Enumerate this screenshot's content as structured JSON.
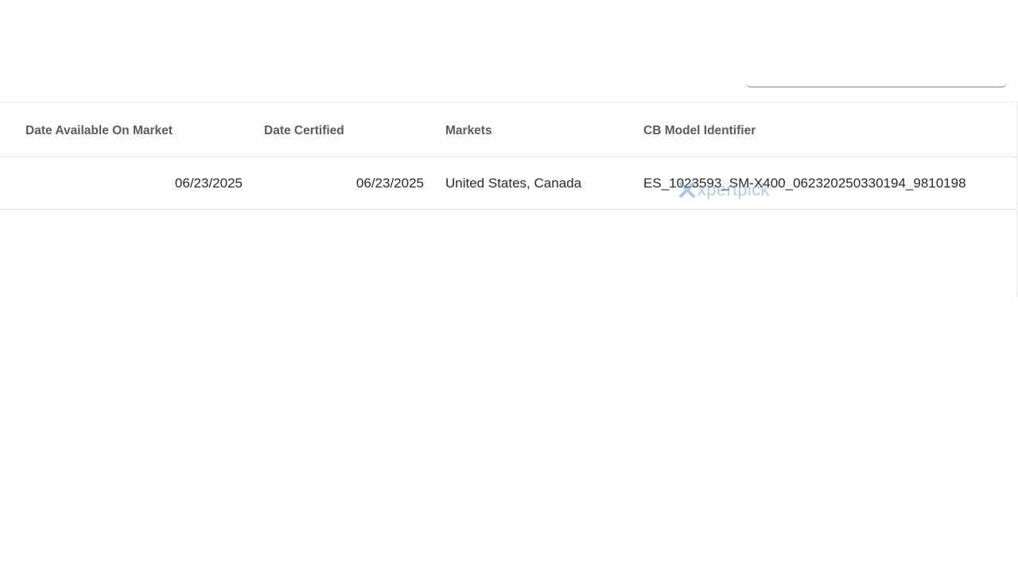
{
  "table": {
    "headers": [
      "Date Available On Market",
      "Date Certified",
      "Markets",
      "CB Model Identifier"
    ],
    "rows": [
      {
        "date_available": "06/23/2025",
        "date_certified": "06/23/2025",
        "markets": "United States, Canada",
        "cb_model_identifier": "ES_1023593_SM-X400_062320250330194_9810198"
      }
    ]
  },
  "watermark": {
    "text": "xpertpick",
    "icon": "x-logo-icon",
    "color": "#7aa3cf"
  }
}
